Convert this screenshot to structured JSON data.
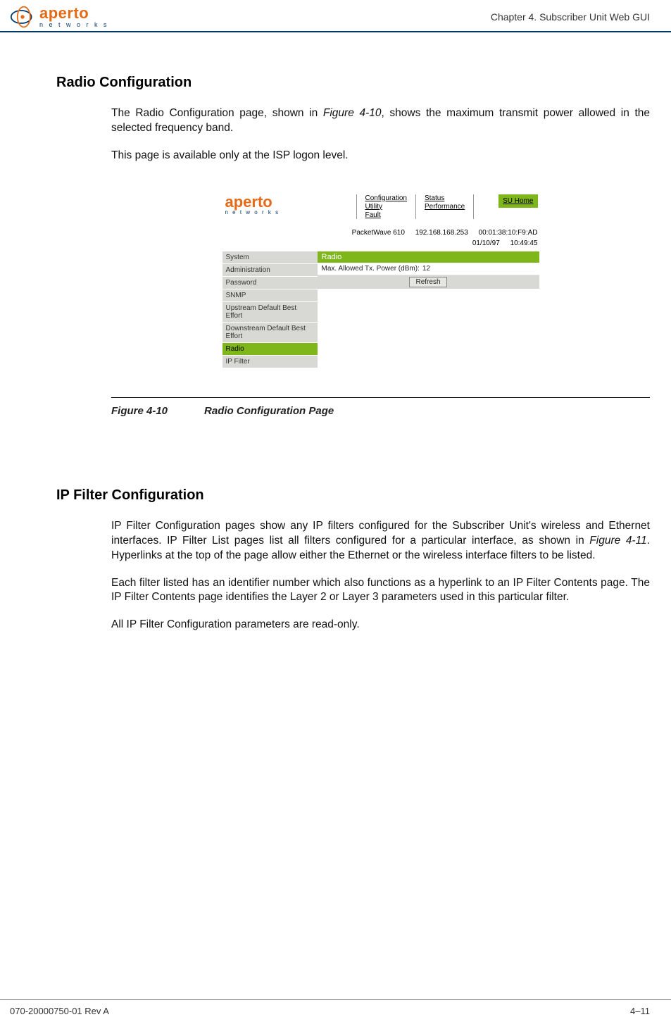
{
  "header": {
    "logo_main": "aperto",
    "logo_sub": "n e t w o r k s",
    "chapter_label": "Chapter 4.  Subscriber Unit Web GUI"
  },
  "section1": {
    "heading": "Radio Configuration",
    "para1_a": "The Radio Configuration page, shown in ",
    "para1_ref": "Figure 4-10",
    "para1_b": ", shows the maximum transmit power allowed in the selected frequency band.",
    "para2": "This page is available only at the ISP logon level."
  },
  "screenshot": {
    "logo_main": "aperto",
    "logo_sub": "n e t w o r k s",
    "nav1_a": "Configuration",
    "nav1_b": "Utility",
    "nav1_c": "Fault",
    "nav2_a": "Status",
    "nav2_b": "Performance",
    "su_home": "SU Home",
    "info_device": "PacketWave 610",
    "info_ip": "192.168.168.253",
    "info_mac": "00:01:38:10:F9:AD",
    "info_date": "01/10/97",
    "info_time": "10:49:45",
    "sidebar": {
      "s0": "System",
      "s1": "Administration",
      "s2": "Password",
      "s3": "SNMP",
      "s4": "Upstream Default Best Effort",
      "s5": "Downstream Default Best Effort",
      "s6": "Radio",
      "s7": "IP Filter"
    },
    "panel_title": "Radio",
    "row_label": "Max. Allowed Tx. Power (dBm):",
    "row_value": "12",
    "refresh_btn": "Refresh"
  },
  "figure_caption": {
    "num": "Figure 4-10",
    "title": "Radio Configuration Page"
  },
  "section2": {
    "heading": "IP Filter Configuration",
    "para1_a": "IP Filter Configuration pages show any IP filters configured for the Subscriber Unit's wireless and Ethernet interfaces. IP Filter List pages list all filters configured for a particular interface, as shown in ",
    "para1_ref": "Figure 4-11",
    "para1_b": ". Hyperlinks at the top of the page allow either the Ethernet or the wireless interface filters to be listed.",
    "para2": "Each filter listed has an identifier number which also functions as a hyperlink to an IP Filter Contents page. The IP Filter Contents page identifies the Layer 2 or Layer 3 parameters used in this particular filter.",
    "para3": "All IP Filter Configuration parameters are read-only."
  },
  "footer": {
    "doc_id": "070-20000750-01 Rev A",
    "page_num": "4–11"
  }
}
